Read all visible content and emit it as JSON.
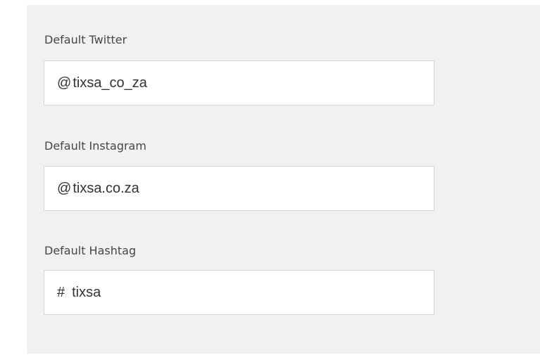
{
  "fields": [
    {
      "label": "Default Twitter",
      "prefix": "@",
      "value": "tixsa_co_za"
    },
    {
      "label": "Default Instagram",
      "prefix": "@",
      "value": "tixsa.co.za"
    },
    {
      "label": "Default Hashtag",
      "prefix": "#",
      "value": "tixsa"
    }
  ]
}
